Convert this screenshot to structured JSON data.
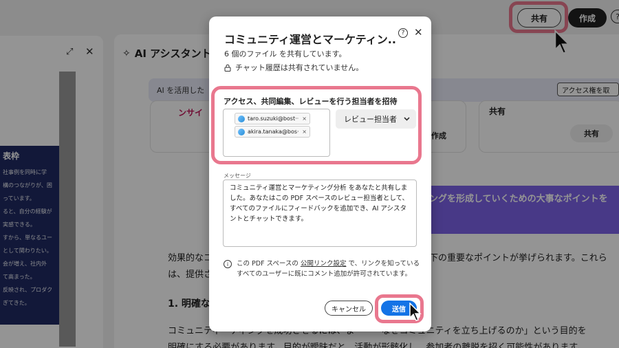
{
  "header": {
    "share_label": "共有",
    "create_label": "作成",
    "help_glyph": "?"
  },
  "left_panel": {
    "card_title": "表枠",
    "lines": [
      "社事例を同時に学",
      "構のつながりが、困",
      "っています。",
      "ると、自分の経験が",
      "実感できる。",
      "すから、単なるユー",
      "として関わりたい。",
      "会が増え、社内外",
      "て高まった。",
      "反映され、プロダク",
      "ぎてきた。"
    ]
  },
  "main": {
    "ai_title": "AI アシスタント",
    "banner_text": "AI を活用した",
    "access_button": "アクセス権を取",
    "card1_text": "ンサイ",
    "card2_button": "作成",
    "card3_label": "共有",
    "card3_button": "共有",
    "purple_text": "ングを形成していくための大事なポイントを",
    "para1_left": "効果的なコ",
    "para1_right": "下の重要なポイントが挙げられます。これら",
    "para2_left": "は、提供さ",
    "heading": "1. 明確な",
    "para3": "コミュニティ　ティングを成功させるには、ま　　　なぜコミュニティを立ち上げるのか」という目的を",
    "para4": "明確にする必要があります。目的が曖昧だと、活動が形骸化し、参加者の離脱を招く可能性があります。"
  },
  "dialog": {
    "title": "コミュニティ運営とマーケティン...",
    "subtitle": "6 個のファイル を共有しています。",
    "chat_note": "チャット履歴は共有されていません。",
    "invite_label": "アクセス、共同編集、レビューを行う担当者を招待",
    "invitees": [
      {
        "email": "taro.suzuki@bost···"
      },
      {
        "email": "akira.tanaka@bos···"
      }
    ],
    "role": "レビュー担当者",
    "message_label": "メッセージ",
    "message": "コミュニティ運営とマーケティング分析 をあなたと共有しました。あなたはこの PDF スペースのレビュー担当者として、すべてのファイルにフィードバックを追加でき、AI アシスタントとチャットできます。",
    "info_prefix": "この PDF スペースの ",
    "info_link": "公開リンク設定",
    "info_suffix": " で、リンクを知っているすべてのユーザーに既にコメント追加が許可されています。",
    "cancel_label": "キャンセル",
    "send_label": "送信"
  },
  "colors": {
    "highlight": "#e9778e",
    "primary": "#1473e6",
    "purple": "#7d63e8",
    "navy": "#1f2a63"
  }
}
